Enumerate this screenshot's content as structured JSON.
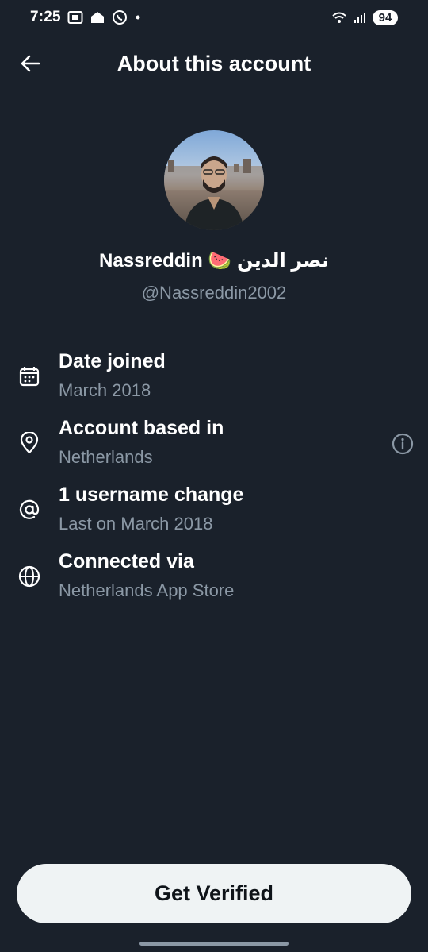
{
  "status_bar": {
    "time": "7:25",
    "battery": "94",
    "icons": [
      "screenshot-icon",
      "cloud-icon",
      "whatsapp-icon",
      "dot-icon",
      "wifi-icon",
      "signal-icon"
    ]
  },
  "header": {
    "title": "About this account",
    "back_icon": "arrow-left-icon"
  },
  "profile": {
    "display_name": "Nassreddin 🍉 نصر الدين",
    "handle": "@Nassreddin2002"
  },
  "details": [
    {
      "icon": "calendar-icon",
      "title": "Date joined",
      "subtitle": "March 2018"
    },
    {
      "icon": "location-pin-icon",
      "title": "Account based in",
      "subtitle": "Netherlands",
      "trailing_icon": "info-icon"
    },
    {
      "icon": "at-sign-icon",
      "title": "1 username change",
      "subtitle": "Last on March 2018"
    },
    {
      "icon": "globe-icon",
      "title": "Connected via",
      "subtitle": "Netherlands App Store"
    }
  ],
  "footer": {
    "button_label": "Get Verified"
  },
  "colors": {
    "background": "#1a212b",
    "secondary_text": "#8b98a5",
    "button_background": "#eff3f4",
    "button_text": "#0f1419"
  }
}
